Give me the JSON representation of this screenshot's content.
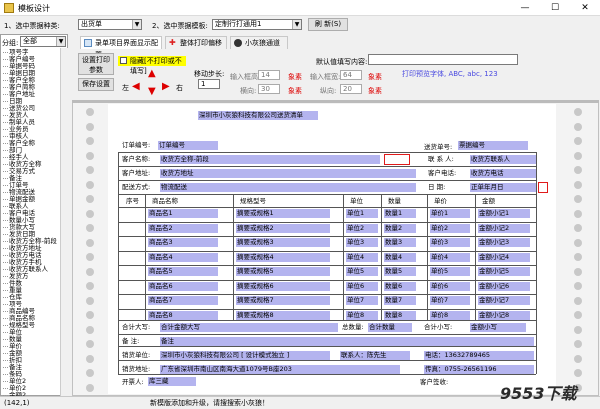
{
  "window": {
    "title": "模板设计",
    "minimize": "—",
    "maximize": "☐",
    "close": "✕"
  },
  "toolbar": {
    "doc_type_label": "1、选中票据种类:",
    "doc_type_value": "出货单",
    "template_label": "2、选中票据模板:",
    "template_value": "定制行打通用1",
    "refresh_label": "刷 新(S)"
  },
  "left_panel": {
    "group_label": "分组:",
    "group_value": "全部",
    "items": [
      "项号字",
      "客户编号",
      "单据号码",
      "单据日期",
      "客户全称",
      "客户简称",
      "客户地址",
      "日期",
      "送货公司",
      "发货人",
      "制单人员",
      "业务员",
      "审核人",
      "客户全称",
      "部门",
      "经手人",
      "收货方全称",
      "交易方式",
      "备注",
      "订单号",
      "物流配送",
      "单据金额",
      "联系人",
      "客户电话",
      "数量小写",
      "货款大写",
      "发货日期",
      "收货方全称-前段",
      "收货方地址",
      "收货方电话",
      "收货方手机",
      "收货方联系人",
      "发货方",
      "件数",
      "重量",
      "仓库",
      "项号",
      "商品编号",
      "商品名称",
      "规格型号",
      "单位",
      "数量",
      "单价",
      "金额",
      "折扣",
      "备注",
      "条码",
      "单位2",
      "单价2",
      "金额2"
    ]
  },
  "tabs": [
    {
      "label": "录单项目界面显示配置"
    },
    {
      "label": "整体打印偏移"
    },
    {
      "label": "小灰狼通道"
    }
  ],
  "panel": {
    "setup_print": "设置打印参数",
    "save_setup": "保存设置",
    "checkbox_label": "隐藏[不打印或不填写]",
    "default_value_label": "默认值填写内容:",
    "move_step_label": "移动步长:",
    "move_step_value": "1",
    "input_width_label": "输入框高:",
    "input_width_value": "14",
    "width_label": "横向:",
    "width_value": "30",
    "input_width2_label": "输入框宽:",
    "input_width2_value": "64",
    "height_label": "纵向:",
    "height_value": "20",
    "unit": "象素",
    "print_font": "打印预览字体, ABC, abc, 123",
    "left": "左",
    "right": "右"
  },
  "form": {
    "title": "深圳市小灰狼科技有限公司送货清单",
    "order_no_label": "订单编号:",
    "order_no_value": "订单编号",
    "doc_no_label": "送货单号:",
    "doc_no_value": "票据编号",
    "customer_label": "客户名称:",
    "customer_value": "收货方全称-前段",
    "contact_label": "联 系 人:",
    "contact_value": "收货方联系人",
    "address_label": "客户地址:",
    "address_value": "收货方地址",
    "phone_label": "客户电话:",
    "phone_value": "收货方电话",
    "delivery_label": "配送方式:",
    "delivery_value": "物流配送",
    "date_label": "日    期:",
    "date_value": "正单年月日",
    "headers": [
      "序号",
      "商品名称",
      "规格型号",
      "单位",
      "数量",
      "单价",
      "金额"
    ],
    "rows": [
      {
        "name": "商品名1",
        "spec": "摘要或规格1",
        "unit": "单位1",
        "qty": "数量1",
        "price": "单价1",
        "amount": "金额小记1"
      },
      {
        "name": "商品名2",
        "spec": "摘要或规格2",
        "unit": "单位2",
        "qty": "数量2",
        "price": "单价2",
        "amount": "金额小记2"
      },
      {
        "name": "商品名3",
        "spec": "摘要或规格3",
        "unit": "单位3",
        "qty": "数量3",
        "price": "单价3",
        "amount": "金额小记3"
      },
      {
        "name": "商品名4",
        "spec": "摘要或规格4",
        "unit": "单位4",
        "qty": "数量4",
        "price": "单价4",
        "amount": "金额小记4"
      },
      {
        "name": "商品名5",
        "spec": "摘要或规格5",
        "unit": "单位5",
        "qty": "数量5",
        "price": "单价5",
        "amount": "金额小记5"
      },
      {
        "name": "商品名6",
        "spec": "摘要或规格6",
        "unit": "单位6",
        "qty": "数量6",
        "price": "单价6",
        "amount": "金额小记6"
      },
      {
        "name": "商品名7",
        "spec": "摘要或规格7",
        "unit": "单位7",
        "qty": "数量7",
        "price": "单价7",
        "amount": "金额小记7"
      },
      {
        "name": "商品名8",
        "spec": "摘要或规格8",
        "unit": "单位8",
        "qty": "数量8",
        "price": "单价8",
        "amount": "金额小记8"
      }
    ],
    "total_upper_label": "合计大写:",
    "total_upper_value": "合计金额大写",
    "total_qty_label": "总数量:",
    "total_qty_value": "合计数量",
    "total_lower_label": "合计小写:",
    "total_lower_value": "金额小写",
    "remark_label": "备    注:",
    "remark_value": "备注",
    "sender_label": "销货单位:",
    "sender_value": "深圳市小灰狼科技有限公司 [ 设计模式独立 ]",
    "sender_contact": "联系人：陈先生",
    "sender_phone": "电话：13632789465",
    "sender_addr_label": "销货地址:",
    "sender_addr_value": "广东省深圳市南山区南海大道1079号B座203",
    "fax": "传真：0755-26561196",
    "issuer_label": "开票人:",
    "issuer_value": "库三藏",
    "receiver_label": "客户签收:"
  },
  "status": {
    "coords": "(142,1)",
    "message": "新模版添加和升级，请搜搜索小灰狼！",
    "watermark": "9553下载"
  }
}
